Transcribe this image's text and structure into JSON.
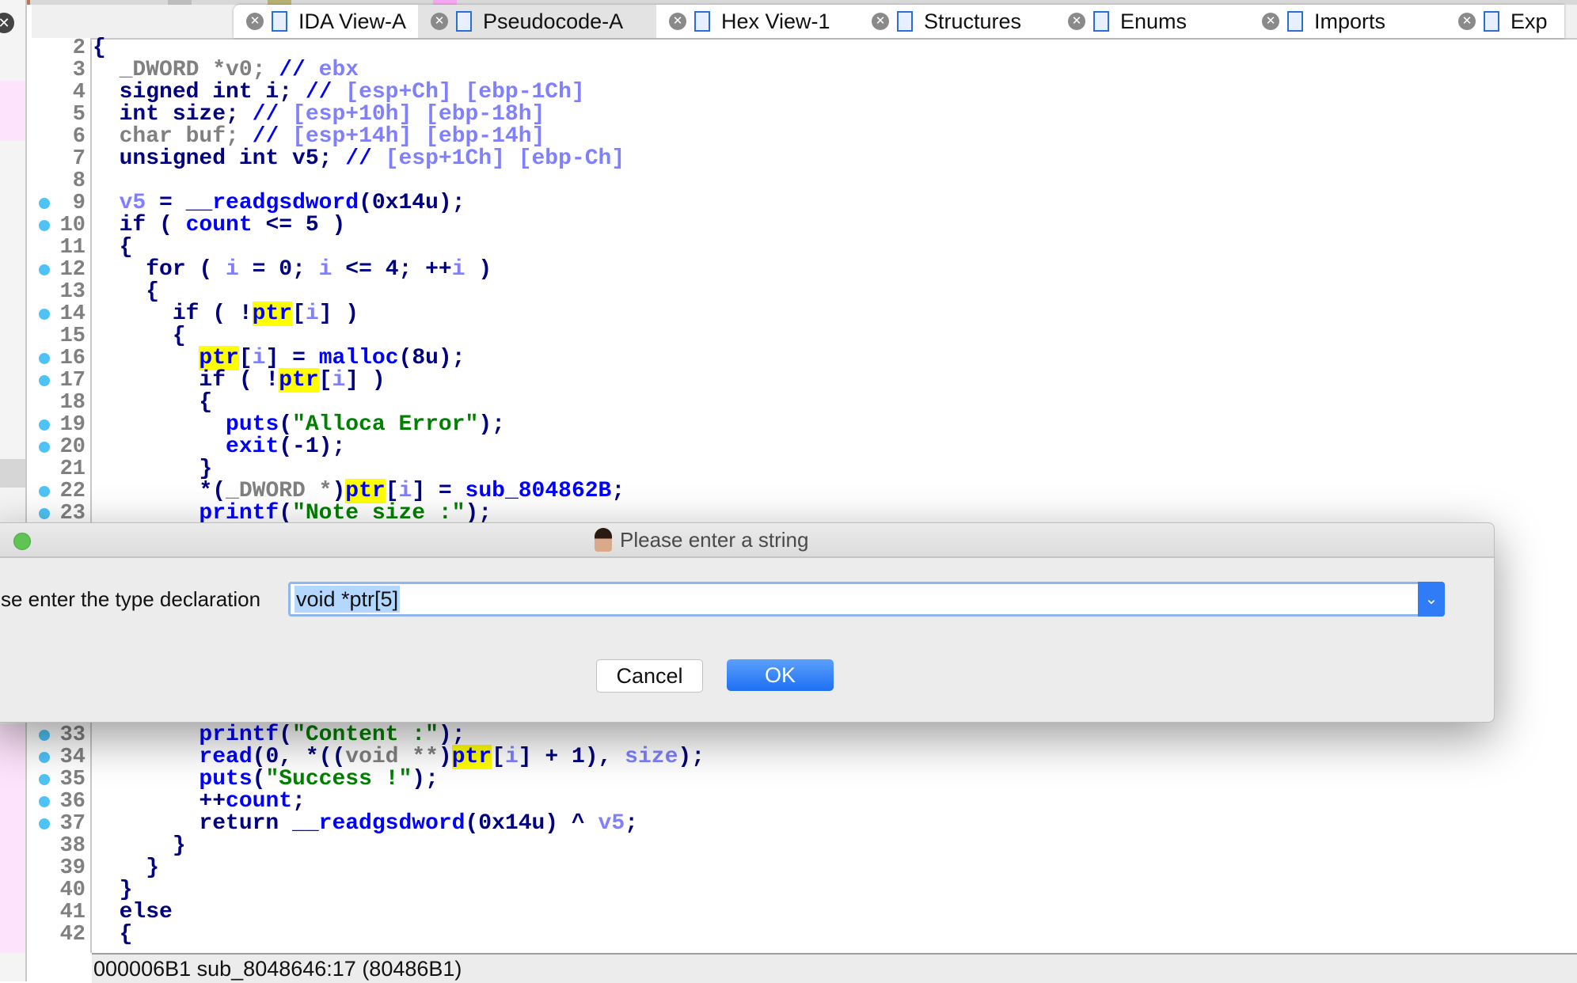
{
  "tabs": [
    {
      "label": "IDA View-A",
      "icon": "disassembly-icon",
      "active": false
    },
    {
      "label": "Pseudocode-A",
      "icon": "pseudocode-icon",
      "active": true
    },
    {
      "label": "Hex View-1",
      "icon": "hex-icon",
      "active": false
    },
    {
      "label": "Structures",
      "icon": "structures-icon",
      "active": false
    },
    {
      "label": "Enums",
      "icon": "enums-icon",
      "active": false
    },
    {
      "label": "Imports",
      "icon": "imports-icon",
      "active": false
    },
    {
      "label": "Exp",
      "icon": "exports-icon",
      "active": false
    }
  ],
  "code_lines": [
    {
      "n": 2,
      "dot": false,
      "tokens": [
        [
          "{",
          "plain"
        ]
      ]
    },
    {
      "n": 3,
      "dot": false,
      "tokens": [
        [
          "  ",
          "plain"
        ],
        [
          "_DWORD *v0;",
          "type"
        ],
        [
          " // ",
          "cmt"
        ],
        [
          "ebx",
          "reg"
        ]
      ]
    },
    {
      "n": 4,
      "dot": false,
      "tokens": [
        [
          "  signed int i;",
          "kw"
        ],
        [
          " // ",
          "cmt"
        ],
        [
          "[esp+Ch] [ebp-1Ch]",
          "reg"
        ]
      ]
    },
    {
      "n": 5,
      "dot": false,
      "tokens": [
        [
          "  int size;",
          "kw"
        ],
        [
          " // ",
          "cmt"
        ],
        [
          "[esp+10h] [ebp-18h]",
          "reg"
        ]
      ]
    },
    {
      "n": 6,
      "dot": false,
      "tokens": [
        [
          "  ",
          "plain"
        ],
        [
          "char buf;",
          "type"
        ],
        [
          " // ",
          "cmt"
        ],
        [
          "[esp+14h] [ebp-14h]",
          "reg"
        ]
      ]
    },
    {
      "n": 7,
      "dot": false,
      "tokens": [
        [
          "  unsigned int v5;",
          "kw"
        ],
        [
          " // ",
          "cmt"
        ],
        [
          "[esp+1Ch] [ebp-Ch]",
          "reg"
        ]
      ]
    },
    {
      "n": 8,
      "dot": false,
      "tokens": []
    },
    {
      "n": 9,
      "dot": true,
      "tokens": [
        [
          "  ",
          "plain"
        ],
        [
          "v5",
          "var"
        ],
        [
          " = ",
          "plain"
        ],
        [
          "__readgsdword",
          "fn"
        ],
        [
          "(0x14u);",
          "plain"
        ]
      ]
    },
    {
      "n": 10,
      "dot": true,
      "tokens": [
        [
          "  if ( ",
          "kw"
        ],
        [
          "count",
          "fn"
        ],
        [
          " <= 5 )",
          "plain"
        ]
      ]
    },
    {
      "n": 11,
      "dot": false,
      "tokens": [
        [
          "  {",
          "plain"
        ]
      ]
    },
    {
      "n": 12,
      "dot": true,
      "tokens": [
        [
          "    for ( ",
          "kw"
        ],
        [
          "i",
          "var"
        ],
        [
          " = 0; ",
          "plain"
        ],
        [
          "i",
          "var"
        ],
        [
          " <= 4; ++",
          "plain"
        ],
        [
          "i",
          "var"
        ],
        [
          " )",
          "plain"
        ]
      ]
    },
    {
      "n": 13,
      "dot": false,
      "tokens": [
        [
          "    {",
          "plain"
        ]
      ]
    },
    {
      "n": 14,
      "dot": true,
      "tokens": [
        [
          "      if ( !",
          "kw"
        ],
        [
          "ptr",
          "hl"
        ],
        [
          "[",
          "plain"
        ],
        [
          "i",
          "var"
        ],
        [
          "] )",
          "plain"
        ]
      ]
    },
    {
      "n": 15,
      "dot": false,
      "tokens": [
        [
          "      {",
          "plain"
        ]
      ]
    },
    {
      "n": 16,
      "dot": true,
      "tokens": [
        [
          "        ",
          "plain"
        ],
        [
          "ptr",
          "hl"
        ],
        [
          "[",
          "plain"
        ],
        [
          "i",
          "var"
        ],
        [
          "] = ",
          "plain"
        ],
        [
          "malloc",
          "fn"
        ],
        [
          "(8u);",
          "plain"
        ]
      ]
    },
    {
      "n": 17,
      "dot": true,
      "tokens": [
        [
          "        if ( !",
          "kw"
        ],
        [
          "ptr",
          "hl"
        ],
        [
          "[",
          "plain"
        ],
        [
          "i",
          "var"
        ],
        [
          "] )",
          "plain"
        ]
      ]
    },
    {
      "n": 18,
      "dot": false,
      "tokens": [
        [
          "        {",
          "plain"
        ]
      ]
    },
    {
      "n": 19,
      "dot": true,
      "tokens": [
        [
          "          ",
          "plain"
        ],
        [
          "puts",
          "fn"
        ],
        [
          "(",
          "plain"
        ],
        [
          "\"Alloca Error\"",
          "str"
        ],
        [
          ");",
          "plain"
        ]
      ]
    },
    {
      "n": 20,
      "dot": true,
      "tokens": [
        [
          "          ",
          "plain"
        ],
        [
          "exit",
          "fn"
        ],
        [
          "(-1);",
          "plain"
        ]
      ]
    },
    {
      "n": 21,
      "dot": false,
      "tokens": [
        [
          "        }",
          "plain"
        ]
      ]
    },
    {
      "n": 22,
      "dot": true,
      "tokens": [
        [
          "        *(",
          "plain"
        ],
        [
          "_DWORD *",
          "type"
        ],
        [
          ")",
          "plain"
        ],
        [
          "ptr",
          "hl"
        ],
        [
          "[",
          "plain"
        ],
        [
          "i",
          "var"
        ],
        [
          "] = ",
          "plain"
        ],
        [
          "sub_804862B",
          "fn"
        ],
        [
          ";",
          "plain"
        ]
      ]
    },
    {
      "n": 23,
      "dot": true,
      "tokens": [
        [
          "        ",
          "plain"
        ],
        [
          "printf",
          "fn"
        ],
        [
          "(",
          "plain"
        ],
        [
          "\"Note size :\"",
          "str"
        ],
        [
          ");",
          "plain"
        ]
      ]
    },
    {
      "n": 33,
      "dot": true,
      "tokens": [
        [
          "        ",
          "plain"
        ],
        [
          "printf",
          "fn"
        ],
        [
          "(",
          "plain"
        ],
        [
          "\"Content :\"",
          "str"
        ],
        [
          ");",
          "plain"
        ]
      ]
    },
    {
      "n": 34,
      "dot": true,
      "tokens": [
        [
          "        ",
          "plain"
        ],
        [
          "read",
          "fn"
        ],
        [
          "(0, *((",
          "plain"
        ],
        [
          "void **",
          "type"
        ],
        [
          ")",
          "plain"
        ],
        [
          "ptr",
          "hl"
        ],
        [
          "[",
          "plain"
        ],
        [
          "i",
          "var"
        ],
        [
          "] + 1), ",
          "plain"
        ],
        [
          "size",
          "var"
        ],
        [
          ");",
          "plain"
        ]
      ]
    },
    {
      "n": 35,
      "dot": true,
      "tokens": [
        [
          "        ",
          "plain"
        ],
        [
          "puts",
          "fn"
        ],
        [
          "(",
          "plain"
        ],
        [
          "\"Success !\"",
          "str"
        ],
        [
          ");",
          "plain"
        ]
      ]
    },
    {
      "n": 36,
      "dot": true,
      "tokens": [
        [
          "        ++",
          "plain"
        ],
        [
          "count",
          "fn"
        ],
        [
          ";",
          "plain"
        ]
      ]
    },
    {
      "n": 37,
      "dot": true,
      "tokens": [
        [
          "        return ",
          "kw"
        ],
        [
          "__readgsdword",
          "fn"
        ],
        [
          "(0x14u) ^ ",
          "plain"
        ],
        [
          "v5",
          "var"
        ],
        [
          ";",
          "plain"
        ]
      ]
    },
    {
      "n": 38,
      "dot": false,
      "tokens": [
        [
          "      }",
          "plain"
        ]
      ]
    },
    {
      "n": 39,
      "dot": false,
      "tokens": [
        [
          "    }",
          "plain"
        ]
      ]
    },
    {
      "n": 40,
      "dot": false,
      "tokens": [
        [
          "  }",
          "plain"
        ]
      ]
    },
    {
      "n": 41,
      "dot": false,
      "tokens": [
        [
          "  else",
          "kw"
        ]
      ]
    },
    {
      "n": 42,
      "dot": false,
      "tokens": [
        [
          "  {",
          "plain"
        ]
      ]
    }
  ],
  "status_bar": {
    "text": "000006B1 sub_8048646:17 (80486B1)"
  },
  "dialog": {
    "title": "Please enter a string",
    "label": "se enter the type declaration",
    "input_value": "void *ptr[5]",
    "cancel_label": "Cancel",
    "ok_label": "OK"
  },
  "colors": {
    "keyword": "#000080",
    "function": "#0000ff",
    "variable": "#8080ff",
    "string": "#008000",
    "type": "#808080",
    "highlight": "#ffff00",
    "accent": "#2f7cf6"
  }
}
